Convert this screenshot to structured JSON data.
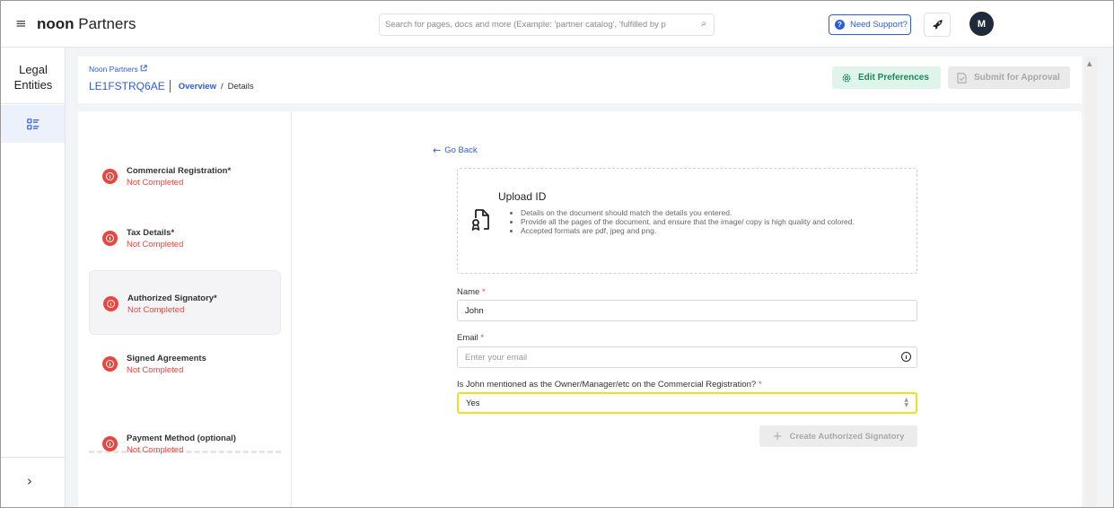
{
  "topbar": {
    "brand_bold": "noon",
    "brand_rest": " Partners",
    "search_placeholder": "Search for pages, docs and more (Example: 'partner catalog', 'fulfilled by p",
    "support_label": "Need Support?",
    "avatar_initial": "M"
  },
  "rail": {
    "title_line1": "Legal",
    "title_line2": "Entities"
  },
  "header": {
    "partner_link": "Noon Partners",
    "entity_id": "LE1FSTRQ6AE",
    "crumb_overview": "Overview",
    "crumb_separator": "/",
    "crumb_details": "Details",
    "edit_preferences": "Edit Preferences",
    "submit_for_approval": "Submit for Approval"
  },
  "steps": [
    {
      "title": "Commercial Registration*",
      "status": "Not Completed"
    },
    {
      "title": "Tax Details*",
      "status": "Not Completed"
    },
    {
      "title": "Authorized Signatory*",
      "status": "Not Completed"
    },
    {
      "title": "Signed Agreements",
      "status": "Not Completed"
    },
    {
      "title": "Payment Method (optional)",
      "status": "Not Completed"
    }
  ],
  "form": {
    "go_back": "Go Back",
    "upload_title": "Upload ID",
    "upload_points": [
      "Details on the document should match the details you entered.",
      "Provide all the pages of the document, and ensure that the image/ copy is high quality and colored.",
      "Accepted formats are pdf, jpeg and png."
    ],
    "name_label": "Name",
    "name_value": "John",
    "email_label": "Email",
    "email_placeholder": "Enter your email",
    "owner_question": "Is John mentioned as the Owner/Manager/etc on the Commercial Registration?",
    "owner_value": "Yes",
    "required_mark": "*",
    "create_button": "Create Authorized Signatory"
  },
  "colors": {
    "accent_blue": "#2e5bd8",
    "error_red": "#e8463f",
    "success_green": "#1a8a5a",
    "highlight_yellow": "#f2e020"
  }
}
